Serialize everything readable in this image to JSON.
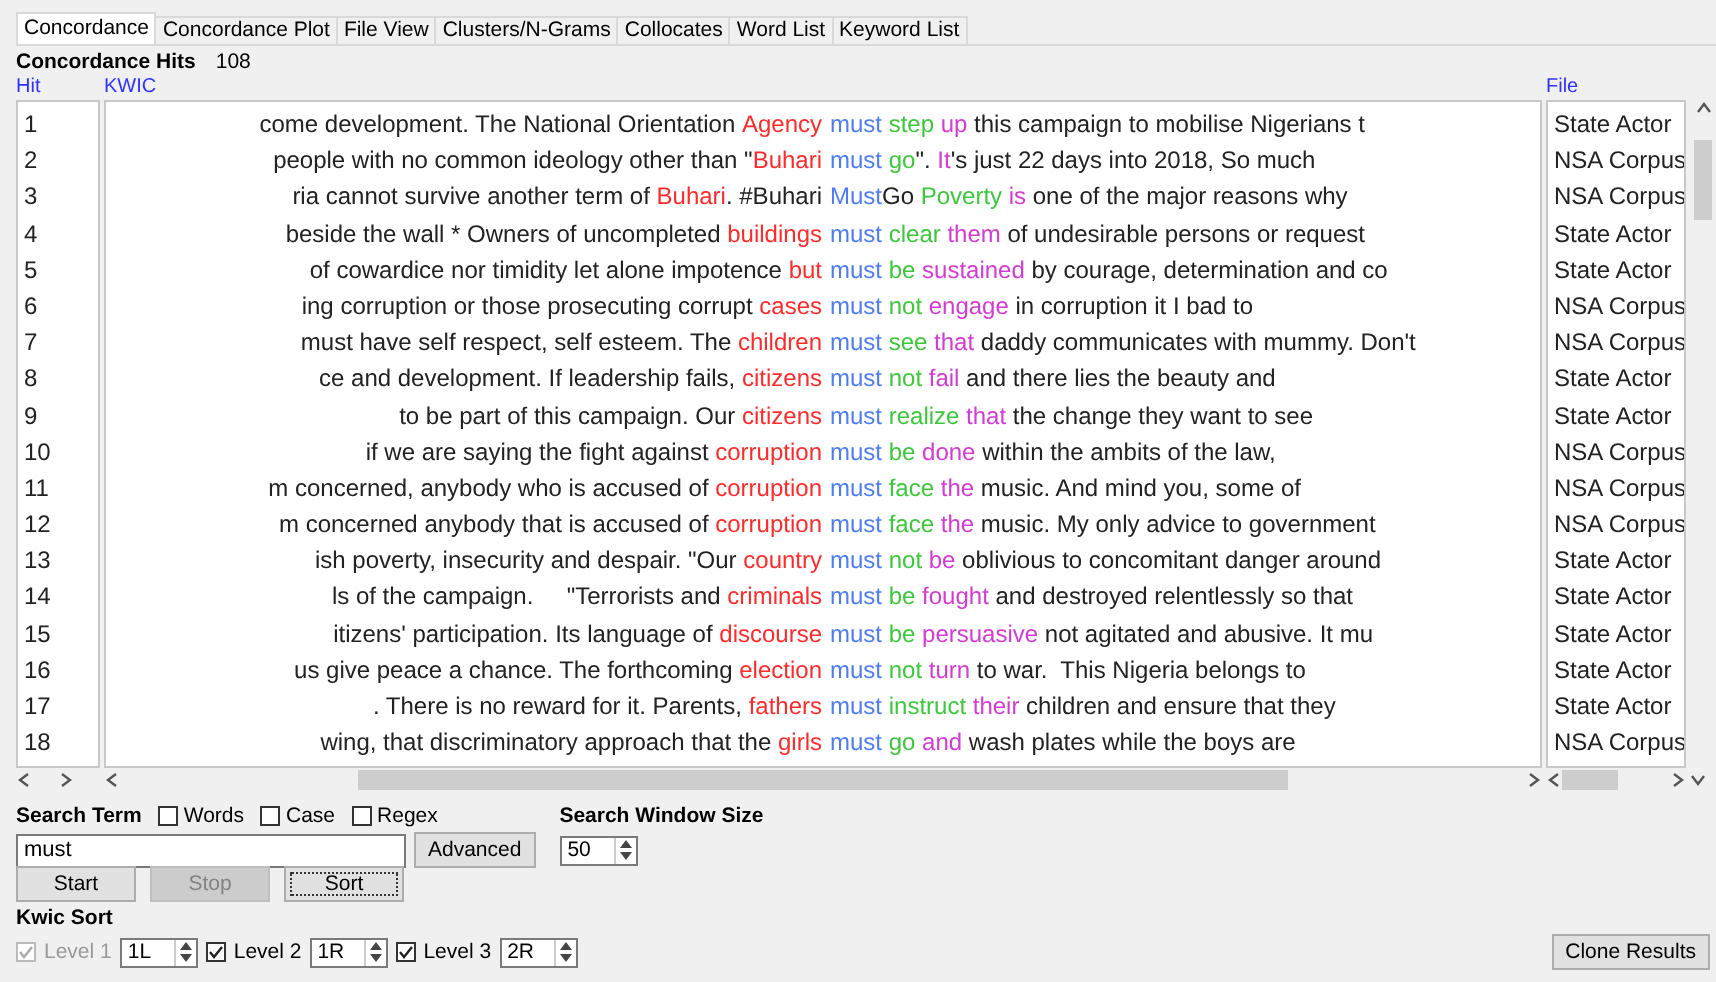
{
  "tabs": [
    {
      "label": "Concordance",
      "selected": true
    },
    {
      "label": "Concordance Plot",
      "selected": false
    },
    {
      "label": "File View",
      "selected": false
    },
    {
      "label": "Clusters/N-Grams",
      "selected": false
    },
    {
      "label": "Collocates",
      "selected": false
    },
    {
      "label": "Word List",
      "selected": false
    },
    {
      "label": "Keyword List",
      "selected": false
    }
  ],
  "hits": {
    "label": "Concordance Hits",
    "count": "108"
  },
  "columns": [
    "Hit",
    "KWIC",
    "File"
  ],
  "rows": [
    {
      "hit": "1",
      "left": [
        {
          "kind": "plain",
          "text": "come development. The National Orientation "
        },
        {
          "kind": "key",
          "text": "Agency"
        }
      ],
      "right": [
        {
          "kind": "node",
          "text": "must"
        },
        {
          "kind": "r1",
          "text": " step"
        },
        {
          "kind": "r2",
          "text": " up"
        },
        {
          "kind": "plain",
          "text": " this campaign to mobilise Nigerians t"
        }
      ],
      "file": "State Actor"
    },
    {
      "hit": "2",
      "left": [
        {
          "kind": "plain",
          "text": "people with no common ideology other than \""
        },
        {
          "kind": "key",
          "text": "Buhari"
        }
      ],
      "right": [
        {
          "kind": "node",
          "text": "must"
        },
        {
          "kind": "r1",
          "text": " go"
        },
        {
          "kind": "plain",
          "text": "\". "
        },
        {
          "kind": "r2",
          "text": "It"
        },
        {
          "kind": "plain",
          "text": "'s just 22 days into 2018, So much"
        }
      ],
      "file": "NSA Corpus"
    },
    {
      "hit": "3",
      "left": [
        {
          "kind": "plain",
          "text": "ria cannot survive another term of "
        },
        {
          "kind": "key",
          "text": "Buhari"
        },
        {
          "kind": "plain",
          "text": ". #Buhari"
        }
      ],
      "right": [
        {
          "kind": "node",
          "text": "Must"
        },
        {
          "kind": "plain",
          "text": "Go"
        },
        {
          "kind": "r1",
          "text": " Poverty"
        },
        {
          "kind": "r2",
          "text": " is"
        },
        {
          "kind": "plain",
          "text": " one of the major reasons why"
        }
      ],
      "file": "NSA Corpus"
    },
    {
      "hit": "4",
      "left": [
        {
          "kind": "plain",
          "text": "beside the wall * Owners of uncompleted "
        },
        {
          "kind": "key",
          "text": "buildings"
        }
      ],
      "right": [
        {
          "kind": "node",
          "text": "must"
        },
        {
          "kind": "r1",
          "text": " clear"
        },
        {
          "kind": "r2",
          "text": " them"
        },
        {
          "kind": "plain",
          "text": " of undesirable persons or request"
        }
      ],
      "file": "State Actor"
    },
    {
      "hit": "5",
      "left": [
        {
          "kind": "plain",
          "text": "of cowardice nor timidity let alone impotence "
        },
        {
          "kind": "key",
          "text": "but"
        }
      ],
      "right": [
        {
          "kind": "node",
          "text": "must"
        },
        {
          "kind": "r1",
          "text": " be"
        },
        {
          "kind": "r2",
          "text": " sustained"
        },
        {
          "kind": "plain",
          "text": " by courage, determination and co"
        }
      ],
      "file": "State Actor"
    },
    {
      "hit": "6",
      "left": [
        {
          "kind": "plain",
          "text": "ing corruption or those prosecuting corrupt "
        },
        {
          "kind": "key",
          "text": "cases"
        }
      ],
      "right": [
        {
          "kind": "node",
          "text": "must"
        },
        {
          "kind": "r1",
          "text": " not"
        },
        {
          "kind": "r2",
          "text": " engage"
        },
        {
          "kind": "plain",
          "text": " in corruption it I bad to"
        }
      ],
      "file": "NSA Corpus"
    },
    {
      "hit": "7",
      "left": [
        {
          "kind": "plain",
          "text": "must have self respect, self esteem. The "
        },
        {
          "kind": "key",
          "text": "children"
        }
      ],
      "right": [
        {
          "kind": "node",
          "text": "must"
        },
        {
          "kind": "r1",
          "text": " see"
        },
        {
          "kind": "r2",
          "text": " that"
        },
        {
          "kind": "plain",
          "text": " daddy communicates with mummy. Don't"
        }
      ],
      "file": "NSA Corpus"
    },
    {
      "hit": "8",
      "left": [
        {
          "kind": "plain",
          "text": "ce and development. If leadership fails, "
        },
        {
          "kind": "key",
          "text": "citizens"
        }
      ],
      "right": [
        {
          "kind": "node",
          "text": "must"
        },
        {
          "kind": "r1",
          "text": " not"
        },
        {
          "kind": "r2",
          "text": " fail"
        },
        {
          "kind": "plain",
          "text": " and there lies the beauty and"
        }
      ],
      "file": "State Actor"
    },
    {
      "hit": "9",
      "left": [
        {
          "kind": "plain",
          "text": "to be part of this campaign. Our "
        },
        {
          "kind": "key",
          "text": "citizens"
        }
      ],
      "right": [
        {
          "kind": "node",
          "text": "must"
        },
        {
          "kind": "r1",
          "text": " realize"
        },
        {
          "kind": "r2",
          "text": " that"
        },
        {
          "kind": "plain",
          "text": " the change they want to see"
        }
      ],
      "file": "State Actor"
    },
    {
      "hit": "10",
      "left": [
        {
          "kind": "plain",
          "text": "if we are saying the fight against "
        },
        {
          "kind": "key",
          "text": "corruption"
        }
      ],
      "right": [
        {
          "kind": "node",
          "text": "must"
        },
        {
          "kind": "r1",
          "text": " be"
        },
        {
          "kind": "r2",
          "text": " done"
        },
        {
          "kind": "plain",
          "text": " within the ambits of the law,"
        }
      ],
      "file": "NSA Corpus"
    },
    {
      "hit": "11",
      "left": [
        {
          "kind": "plain",
          "text": "m concerned, anybody who is accused of "
        },
        {
          "kind": "key",
          "text": "corruption"
        }
      ],
      "right": [
        {
          "kind": "node",
          "text": "must"
        },
        {
          "kind": "r1",
          "text": " face"
        },
        {
          "kind": "r2",
          "text": " the"
        },
        {
          "kind": "plain",
          "text": " music. And mind you, some of"
        }
      ],
      "file": "NSA Corpus"
    },
    {
      "hit": "12",
      "left": [
        {
          "kind": "plain",
          "text": "m concerned anybody that is accused of "
        },
        {
          "kind": "key",
          "text": "corruption"
        }
      ],
      "right": [
        {
          "kind": "node",
          "text": "must"
        },
        {
          "kind": "r1",
          "text": " face"
        },
        {
          "kind": "r2",
          "text": " the"
        },
        {
          "kind": "plain",
          "text": " music. My only advice to government"
        }
      ],
      "file": "NSA Corpus"
    },
    {
      "hit": "13",
      "left": [
        {
          "kind": "plain",
          "text": "ish poverty, insecurity and despair. \"Our "
        },
        {
          "kind": "key",
          "text": "country"
        }
      ],
      "right": [
        {
          "kind": "node",
          "text": "must"
        },
        {
          "kind": "r1",
          "text": " not"
        },
        {
          "kind": "r2",
          "text": " be"
        },
        {
          "kind": "plain",
          "text": " oblivious to concomitant danger around"
        }
      ],
      "file": "State Actor"
    },
    {
      "hit": "14",
      "left": [
        {
          "kind": "plain",
          "text": "ls of the campaign.     \"Terrorists and "
        },
        {
          "kind": "key",
          "text": "criminals"
        }
      ],
      "right": [
        {
          "kind": "node",
          "text": "must"
        },
        {
          "kind": "r1",
          "text": " be"
        },
        {
          "kind": "r2",
          "text": " fought"
        },
        {
          "kind": "plain",
          "text": " and destroyed relentlessly so that"
        }
      ],
      "file": "State Actor"
    },
    {
      "hit": "15",
      "left": [
        {
          "kind": "plain",
          "text": "itizens' participation. Its language of "
        },
        {
          "kind": "key",
          "text": "discourse"
        }
      ],
      "right": [
        {
          "kind": "node",
          "text": "must"
        },
        {
          "kind": "r1",
          "text": " be"
        },
        {
          "kind": "r2",
          "text": " persuasive"
        },
        {
          "kind": "plain",
          "text": " not agitated and abusive. It mu"
        }
      ],
      "file": "State Actor"
    },
    {
      "hit": "16",
      "left": [
        {
          "kind": "plain",
          "text": "us give peace a chance. The forthcoming "
        },
        {
          "kind": "key",
          "text": "election"
        }
      ],
      "right": [
        {
          "kind": "node",
          "text": "must"
        },
        {
          "kind": "r1",
          "text": " not"
        },
        {
          "kind": "r2",
          "text": " turn"
        },
        {
          "kind": "plain",
          "text": " to war.  This Nigeria belongs to"
        }
      ],
      "file": "State Actor"
    },
    {
      "hit": "17",
      "left": [
        {
          "kind": "plain",
          "text": ". There is no reward for it. Parents, "
        },
        {
          "kind": "key",
          "text": "fathers"
        }
      ],
      "right": [
        {
          "kind": "node",
          "text": "must"
        },
        {
          "kind": "r1",
          "text": " instruct"
        },
        {
          "kind": "r2",
          "text": " their"
        },
        {
          "kind": "plain",
          "text": " children and ensure that they"
        }
      ],
      "file": "State Actor"
    },
    {
      "hit": "18",
      "left": [
        {
          "kind": "plain",
          "text": "wing, that discriminatory approach that the "
        },
        {
          "kind": "key",
          "text": "girls"
        }
      ],
      "right": [
        {
          "kind": "node",
          "text": "must"
        },
        {
          "kind": "r1",
          "text": " go"
        },
        {
          "kind": "r2",
          "text": " and"
        },
        {
          "kind": "plain",
          "text": " wash plates while the boys are"
        }
      ],
      "file": "NSA Corpus"
    }
  ],
  "search": {
    "label": "Search Term",
    "options": [
      {
        "label": "Words",
        "checked": false
      },
      {
        "label": "Case",
        "checked": false
      },
      {
        "label": "Regex",
        "checked": false
      }
    ],
    "value": "must",
    "advanced": "Advanced",
    "window_label": "Search Window Size",
    "window_value": "50"
  },
  "actions": [
    {
      "label": "Start",
      "disabled": false,
      "focused": false
    },
    {
      "label": "Stop",
      "disabled": true,
      "focused": false
    },
    {
      "label": "Sort",
      "disabled": false,
      "focused": true
    }
  ],
  "kwic_sort": {
    "label": "Kwic Sort",
    "levels": [
      {
        "label": "Level 1",
        "checked": true,
        "disabled": true,
        "value": "1L"
      },
      {
        "label": "Level 2",
        "checked": true,
        "disabled": false,
        "value": "1R"
      },
      {
        "label": "Level 3",
        "checked": true,
        "disabled": false,
        "value": "2R"
      }
    ]
  },
  "clone": "Clone Results"
}
